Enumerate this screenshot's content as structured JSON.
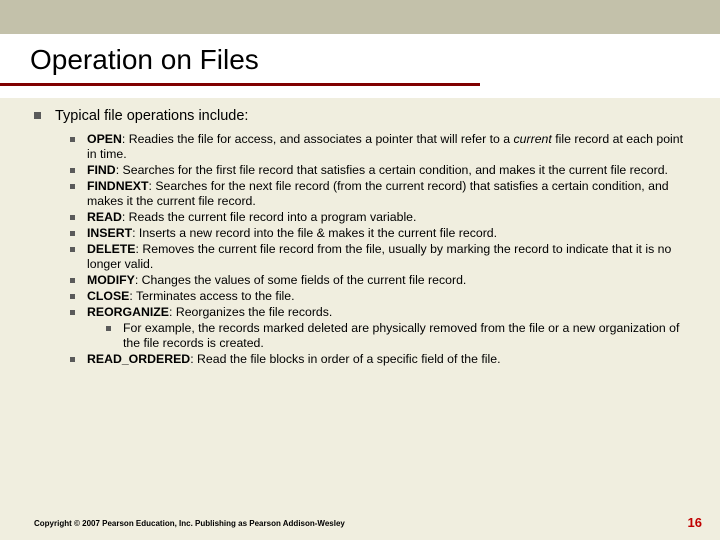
{
  "title": "Operation on Files",
  "lead": "Typical file operations include:",
  "ops": [
    {
      "name": "OPEN",
      "desc_a": ": Readies the file for access, and associates a pointer that will refer to a ",
      "italic": "current",
      "desc_b": " file record at each point in time."
    },
    {
      "name": "FIND",
      "desc_a": ": Searches for the first file record that satisfies a certain condition, and makes it the current file record.",
      "italic": "",
      "desc_b": ""
    },
    {
      "name": "FINDNEXT",
      "desc_a": ": Searches for the next file record (from the current record) that satisfies a certain condition, and makes it the current file record.",
      "italic": "",
      "desc_b": ""
    },
    {
      "name": "READ",
      "desc_a": ": Reads the current file record into a program variable.",
      "italic": "",
      "desc_b": ""
    },
    {
      "name": "INSERT",
      "desc_a": ": Inserts a new record into the file & makes it the current file record.",
      "italic": "",
      "desc_b": ""
    },
    {
      "name": "DELETE",
      "desc_a": ": Removes the current file record from the file, usually by marking the record to indicate that it is no longer valid.",
      "italic": "",
      "desc_b": ""
    },
    {
      "name": "MODIFY",
      "desc_a": ": Changes the values of some fields of the current file record.",
      "italic": "",
      "desc_b": ""
    },
    {
      "name": "CLOSE",
      "desc_a": ": Terminates access to the file.",
      "italic": "",
      "desc_b": ""
    },
    {
      "name": "REORGANIZE",
      "desc_a": ": Reorganizes the file records.",
      "italic": "",
      "desc_b": ""
    }
  ],
  "reorganize_example": "For example, the records marked deleted are physically removed from the file or a new organization of the file records is created.",
  "last_op": {
    "name": "READ_ORDERED",
    "desc": ": Read the file blocks in order of a specific field of the file."
  },
  "copyright": "Copyright © 2007 Pearson Education, Inc. Publishing as Pearson Addison-Wesley",
  "page_number": "16"
}
